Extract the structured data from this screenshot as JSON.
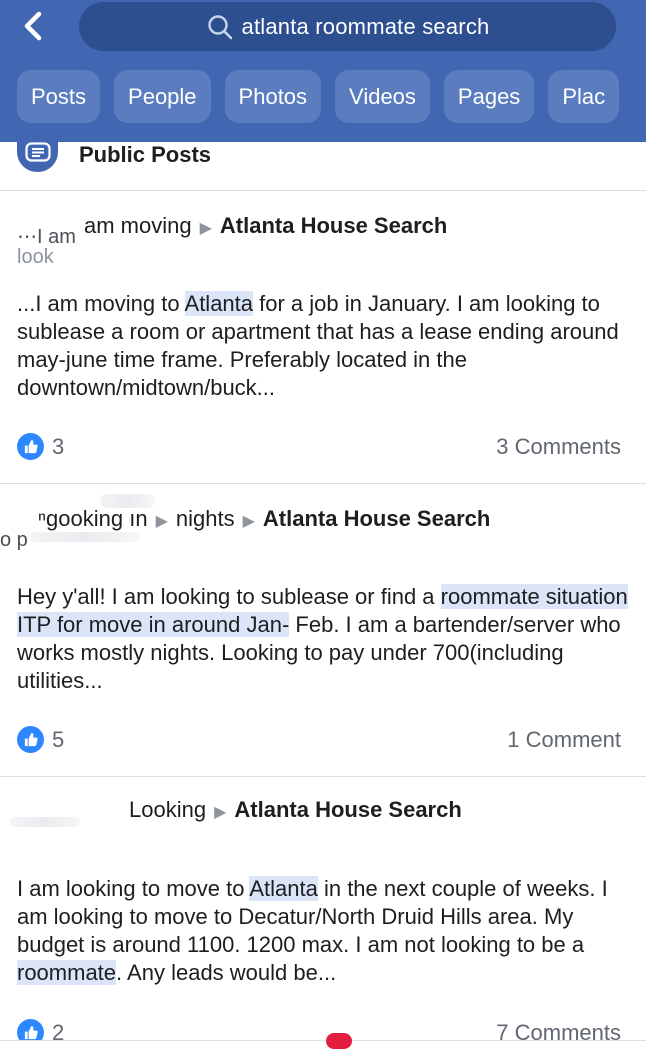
{
  "search": {
    "query": "atlanta roommate search"
  },
  "filters": [
    "Posts",
    "People",
    "Photos",
    "Videos",
    "Pages",
    "Plac"
  ],
  "section": {
    "title": "Public Posts"
  },
  "colors": {
    "header": "#4267b2",
    "highlight": "#dbe5f7",
    "like": "#2d88ff"
  },
  "posts": [
    {
      "garble_line1": "⋯I am",
      "garble_line2": "look",
      "lead": "am moving",
      "group": "Atlanta House Search",
      "body_parts": [
        {
          "t": "...I am moving to ",
          "hl": false
        },
        {
          "t": "Atlanta",
          "hl": true
        },
        {
          "t": " for a job in January. I am looking to sublease a room or apartment that has a lease ending around may-june time frame. Preferably located in the downtown/midtown/buck...",
          "hl": false
        }
      ],
      "likes": "3",
      "comments": "3 Comments"
    },
    {
      "garble_line1": "o p",
      "garble_line2": "",
      "lead": "ⁿɡooking ın",
      "lead2": "nights",
      "group": "Atlanta House Search",
      "body_parts": [
        {
          "t": "Hey y'all! I am looking to sublease or find a ",
          "hl": false
        },
        {
          "t": "roommate situation ITP for move in around Jan-",
          "hl": true
        },
        {
          "t": " Feb. I am a bartender/server who works mostly nights. Looking to pay under 700(including utilities...",
          "hl": false
        }
      ],
      "likes": "5",
      "comments": "1 Comment"
    },
    {
      "lead": "Looking",
      "group": "Atlanta House Search",
      "body_parts": [
        {
          "t": "I am looking to move to ",
          "hl": false
        },
        {
          "t": "Atlanta",
          "hl": true
        },
        {
          "t": " in the next couple of weeks. I am looking to move to Decatur/North Druid Hills area. My budget is around 1100. 1200 max. I am not looking to be a ",
          "hl": false
        },
        {
          "t": "roommate",
          "hl": true
        },
        {
          "t": ". Any leads would be...",
          "hl": false
        }
      ],
      "likes": "2",
      "comments": "7 Comments"
    }
  ]
}
